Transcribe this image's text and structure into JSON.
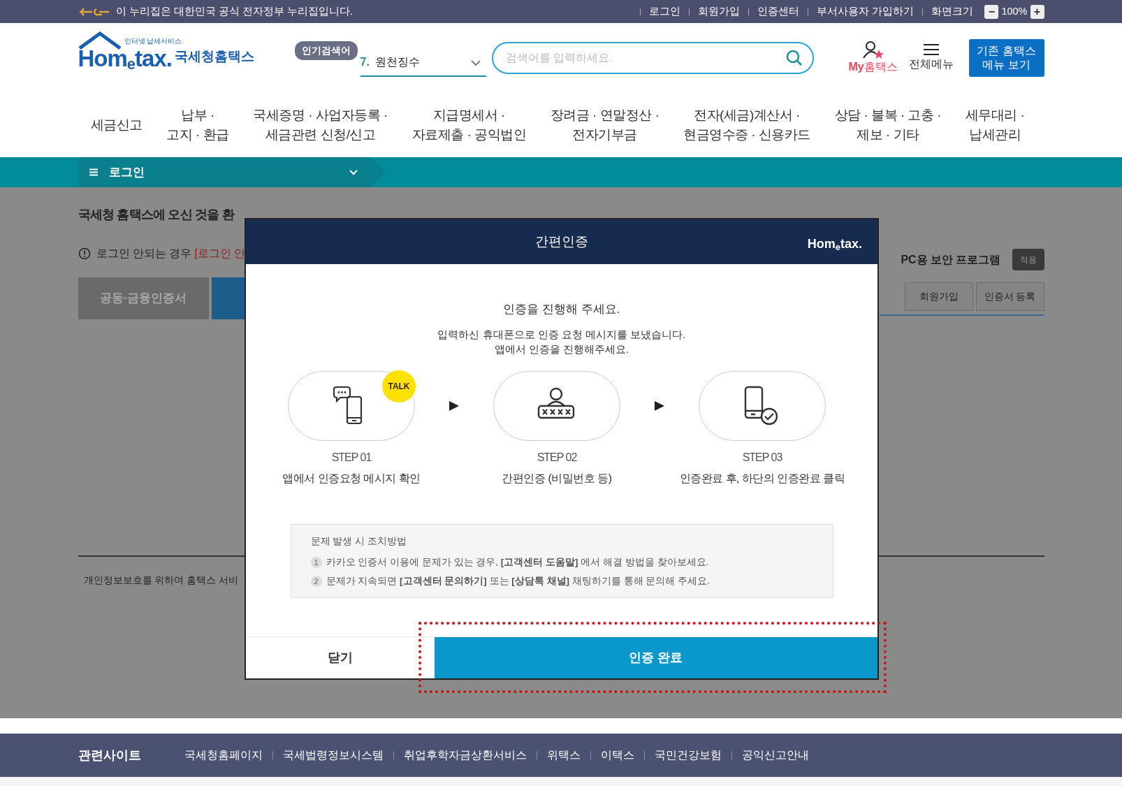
{
  "gov_bar": {
    "notice": "이 누리집은 대한민국 공식 전자정부 누리집입니다.",
    "links": [
      "로그인",
      "회원가입",
      "인증센터",
      "부서사용자 가입하기"
    ],
    "zoom_label": "화면크기",
    "zoom_out": "−",
    "zoom_value": "100%",
    "zoom_in": "+"
  },
  "header": {
    "logo": {
      "tagline": "인터넷 납세서비스",
      "wordmark": "Hom$_{e}$tax.",
      "name": "국세청홈택스"
    },
    "popular": {
      "badge": "인기검색어",
      "rank": "7.",
      "keyword": "원천징수"
    },
    "search": {
      "placeholder": "검색어를 입력하세요."
    },
    "my_hometax": {
      "prefix": "My",
      "label": "홈택스"
    },
    "all_menu": "전체메뉴",
    "legacy_button": "기존 홈택스 메뉴 보기"
  },
  "nav": [
    {
      "lines": [
        "세금신고"
      ]
    },
    {
      "lines": [
        "납부 ·",
        "고지 · 환급"
      ]
    },
    {
      "lines": [
        "국세증명 · 사업자등록 ·",
        "세금관련 신청/신고"
      ]
    },
    {
      "lines": [
        "지급명세서 ·",
        "자료제출 · 공익법인"
      ]
    },
    {
      "lines": [
        "장려금 · 연말정산 ·",
        "전자기부금"
      ]
    },
    {
      "lines": [
        "전자(세금)계산서 ·",
        "현금영수증 · 신용카드"
      ]
    },
    {
      "lines": [
        "상담 · 불복 · 고충 ·",
        "제보 · 기타"
      ]
    },
    {
      "lines": [
        "세무대리 ·",
        "납세관리"
      ]
    }
  ],
  "breadcrumb": {
    "label": "로그인"
  },
  "page": {
    "welcome": "국세청 홈택스에 오신 것을 환",
    "notice": "로그인 안되는 경우",
    "notice_link": "[로그인 안",
    "tabs": [
      {
        "label": "공동·금융인증서",
        "selected": false
      },
      {
        "selected": true
      }
    ],
    "security_label": "PC용 보안 프로그램",
    "security_button": "적용",
    "buttons": [
      "회원가입",
      "인증서 등록"
    ],
    "privacy_note": "개인정보보호를 위하여 홈택스 서비"
  },
  "modal": {
    "title": "간편인증",
    "logo": "Hom$_{e}$tax.",
    "heading": "인증을 진행해 주세요.",
    "message": [
      "입력하신 휴대폰으로 인증 요청 메시지를 보냈습니다.",
      "앱에서 인증을 진행해주세요."
    ],
    "steps": [
      {
        "kind": "message",
        "badge": "TALK",
        "label": "STEP 01",
        "desc": "앱에서 인증요청 메시지 확인"
      },
      {
        "kind": "password",
        "label": "STEP 02",
        "desc": "간편인증 (비밀번호 등)"
      },
      {
        "kind": "complete",
        "label": "STEP 03",
        "desc": "인증완료 후, 하단의 인증완료 클릭"
      }
    ],
    "help": {
      "title": "문제 발생 시 조치방법",
      "items": [
        {
          "num": "1",
          "parts": [
            {
              "kind": "text",
              "text": "카카오 인증서 이용에 문제가 있는 경우, "
            },
            {
              "kind": "link",
              "text": "[고객센터 도움말]"
            },
            {
              "kind": "text",
              "text": " 에서 해결 방법을 찾아보세요."
            }
          ]
        },
        {
          "num": "2",
          "parts": [
            {
              "kind": "text",
              "text": "문제가 지속되면 "
            },
            {
              "kind": "link",
              "text": "[고객센터 문의하기]"
            },
            {
              "kind": "text",
              "text": " 또는 "
            },
            {
              "kind": "link",
              "text": "[상담톡 채널]"
            },
            {
              "kind": "text",
              "text": " 채팅하기를 통해 문의해 주세요."
            }
          ]
        }
      ]
    },
    "close_button": "닫기",
    "confirm_button": "인증 완료",
    "confirm_highlighted": true
  },
  "footer": {
    "title": "관련사이트",
    "links": [
      "국세청홈페이지",
      "국세법령정보시스템",
      "취업후학자금상환서비스",
      "위택스",
      "이택스",
      "국민건강보험",
      "공익신고안내"
    ]
  }
}
